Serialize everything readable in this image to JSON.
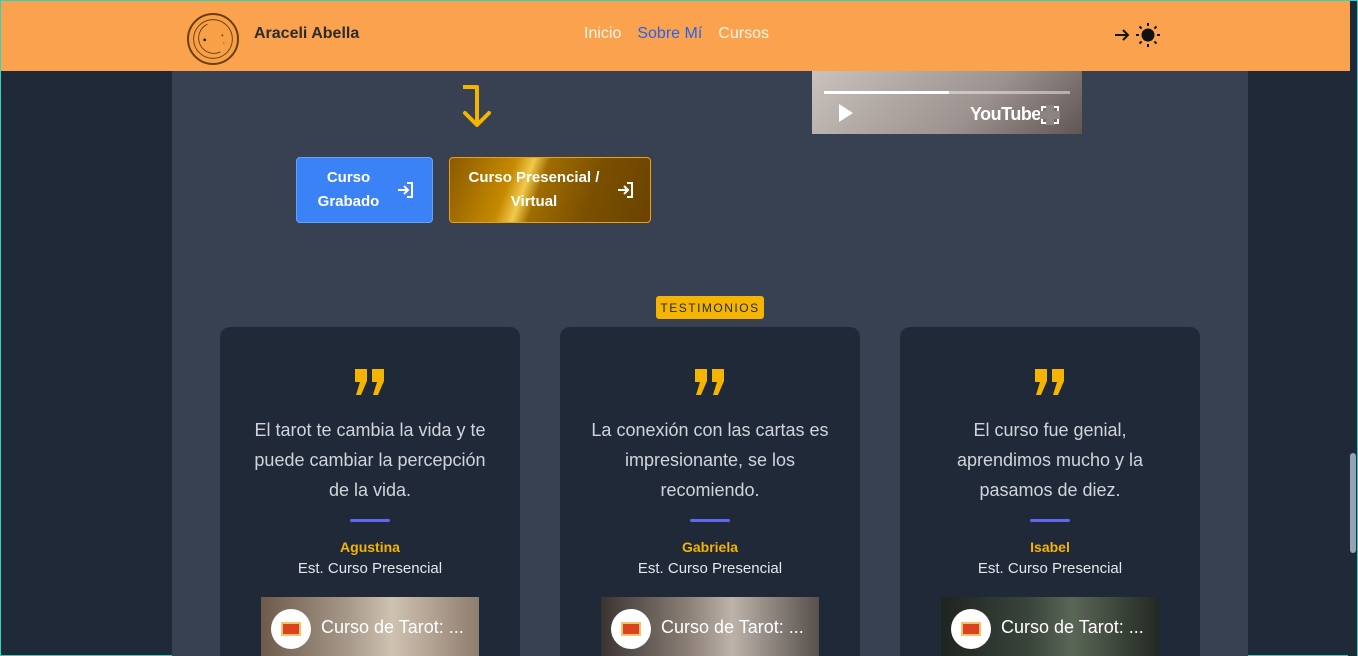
{
  "header": {
    "brand": "Araceli Abella",
    "nav": [
      "Inicio",
      "Sobre Mí",
      "Cursos"
    ],
    "active_nav": "Sobre Mí"
  },
  "video": {
    "platform": "YouTube"
  },
  "buttons": {
    "recorded": "Curso Grabado",
    "inperson": "Curso Presencial / Virtual"
  },
  "section_badge": "TESTIMONIOS",
  "testimonials": [
    {
      "text": "El tarot te cambia la vida y te puede cambiar la percepción de la vida.",
      "name": "Agustina",
      "role": "Est. Curso Presencial",
      "video_title": "Curso de Tarot: ..."
    },
    {
      "text": "La conexión con las cartas es impresionante, se los recomiendo.",
      "name": "Gabriela",
      "role": "Est. Curso Presencial",
      "video_title": "Curso de Tarot: ..."
    },
    {
      "text": "El curso fue genial, aprendimos mucho y la pasamos de diez.",
      "name": "Isabel",
      "role": "Est. Curso Presencial",
      "video_title": "Curso de Tarot: ..."
    }
  ],
  "colors": {
    "header_bg": "#fba24e",
    "accent_gold": "#f5b400",
    "accent_blue": "#3b82f6",
    "divider": "#6366f1",
    "card_bg": "#1f2937",
    "band_bg": "#374151"
  }
}
